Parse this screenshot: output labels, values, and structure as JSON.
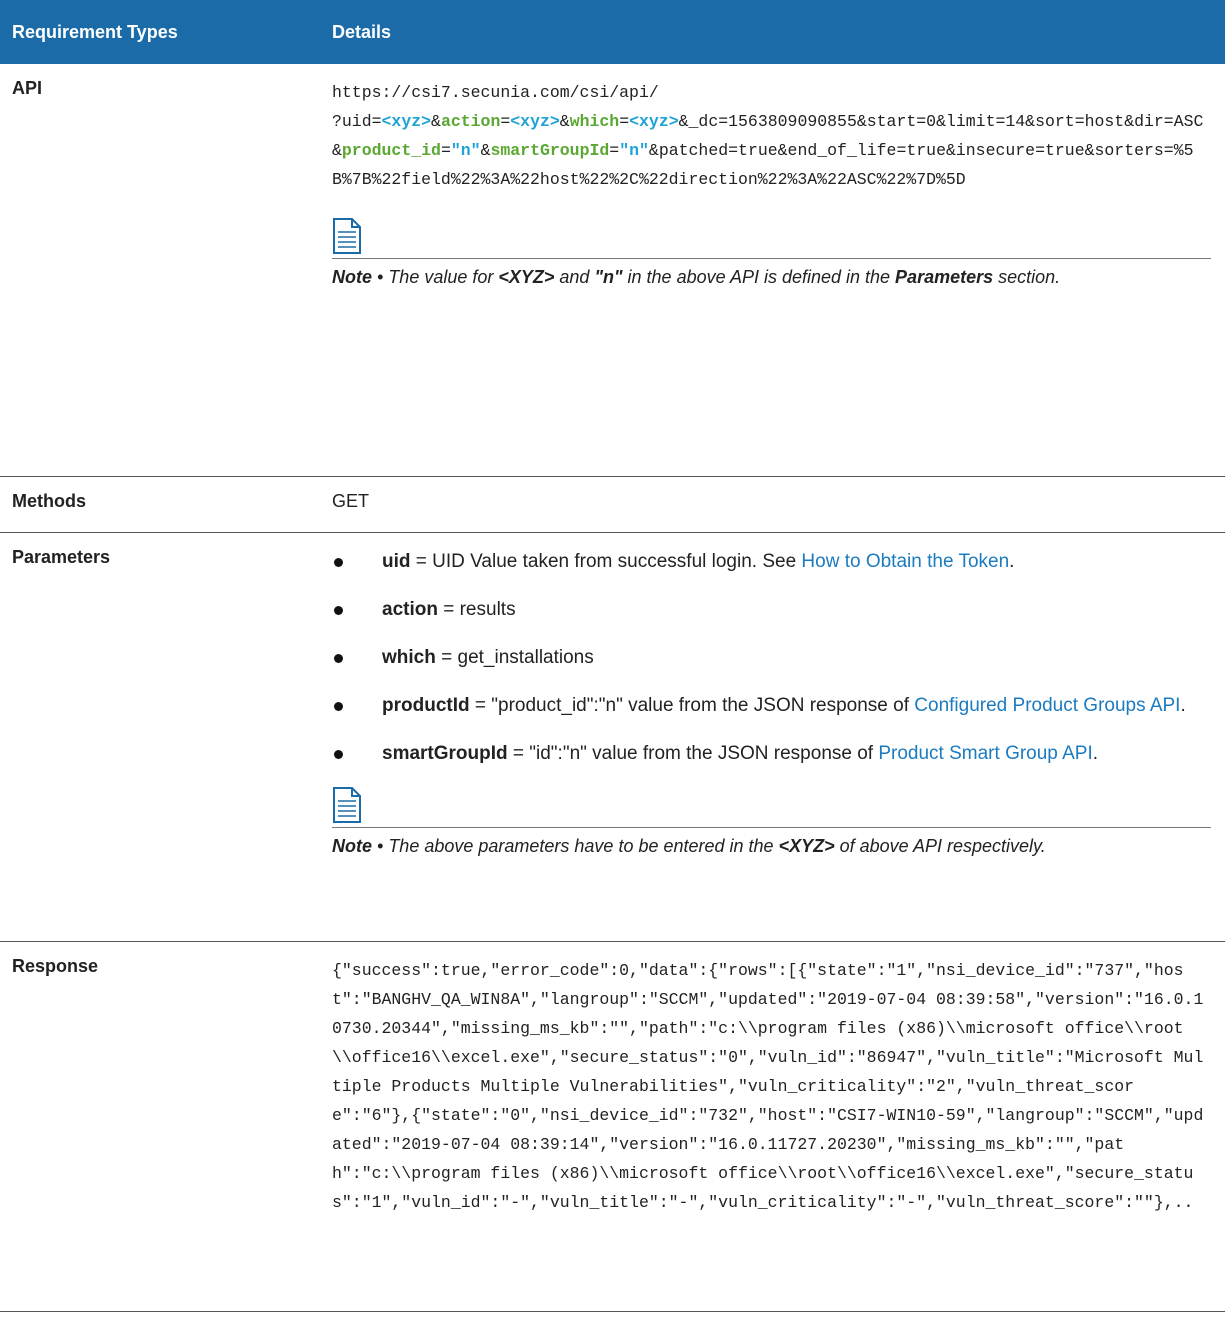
{
  "header": {
    "col1": "Requirement Types",
    "col2": "Details"
  },
  "api": {
    "label": "API",
    "url_parts": [
      {
        "t": "https://csi7.secunia.com/csi/api/\n?uid=",
        "c": ""
      },
      {
        "t": "<xyz>",
        "c": "kb"
      },
      {
        "t": "&",
        "c": ""
      },
      {
        "t": "action",
        "c": "kg"
      },
      {
        "t": "=",
        "c": ""
      },
      {
        "t": "<xyz>",
        "c": "kb"
      },
      {
        "t": "&",
        "c": ""
      },
      {
        "t": "which",
        "c": "kg"
      },
      {
        "t": "=",
        "c": ""
      },
      {
        "t": "<xyz>",
        "c": "kb"
      },
      {
        "t": "&_dc=1563809090855&start=0&limit=14&sort=host&dir=ASC&",
        "c": ""
      },
      {
        "t": "product_id",
        "c": "kg"
      },
      {
        "t": "=",
        "c": ""
      },
      {
        "t": "\"n\"",
        "c": "kb"
      },
      {
        "t": "&",
        "c": ""
      },
      {
        "t": "smartGroupId",
        "c": "kg"
      },
      {
        "t": "=",
        "c": ""
      },
      {
        "t": "\"n\"",
        "c": "kb"
      },
      {
        "t": "&patched=true&end_of_life=true&insecure=true&sorters=%5B%7B%22field%22%3A%22host%22%2C%22direction%22%3A%22ASC%22%7D%5D",
        "c": ""
      }
    ],
    "note": {
      "lead": "Note",
      "sep": " • ",
      "t1": "The value for ",
      "b1": "<XYZ>",
      "t2": " and ",
      "b2": "\"n\"",
      "t3": " in the above API is defined in the ",
      "b3": "Parameters",
      "t4": " section."
    }
  },
  "methods": {
    "label": "Methods",
    "value": "GET"
  },
  "parameters": {
    "label": "Parameters",
    "items": [
      {
        "key": "uid",
        "text": " = UID Value taken from successful login. See ",
        "link": "How to Obtain the Token",
        "after": "."
      },
      {
        "key": "action",
        "text": " = results",
        "link": "",
        "after": ""
      },
      {
        "key": "which",
        "text": " = get_installations",
        "link": "",
        "after": ""
      },
      {
        "key": "productId",
        "text": " = \"product_id\":\"n\" value from the JSON response of ",
        "link": "Configured Product Groups API",
        "after": "."
      },
      {
        "key": "smartGroupId",
        "text": " = \"id\":\"n\" value from the JSON response of ",
        "link": "Product Smart Group API",
        "after": "."
      }
    ],
    "note": {
      "lead": "Note",
      "sep": " • ",
      "t1": "The above parameters have to be entered in the ",
      "b1": "<XYZ>",
      "t2": " of above API respectively."
    }
  },
  "response": {
    "label": "Response",
    "value": "{\"success\":true,\"error_code\":0,\"data\":{\"rows\":[{\"state\":\"1\",\"nsi_device_id\":\"737\",\"host\":\"BANGHV_QA_WIN8A\",\"langroup\":\"SCCM\",\"updated\":\"2019-07-04 08:39:58\",\"version\":\"16.0.10730.20344\",\"missing_ms_kb\":\"\",\"path\":\"c:\\\\program files (x86)\\\\microsoft office\\\\root\\\\office16\\\\excel.exe\",\"secure_status\":\"0\",\"vuln_id\":\"86947\",\"vuln_title\":\"Microsoft Multiple Products Multiple Vulnerabilities\",\"vuln_criticality\":\"2\",\"vuln_threat_score\":\"6\"},{\"state\":\"0\",\"nsi_device_id\":\"732\",\"host\":\"CSI7-WIN10-59\",\"langroup\":\"SCCM\",\"updated\":\"2019-07-04 08:39:14\",\"version\":\"16.0.11727.20230\",\"missing_ms_kb\":\"\",\"path\":\"c:\\\\program files (x86)\\\\microsoft office\\\\root\\\\office16\\\\excel.exe\",\"secure_status\":\"1\",\"vuln_id\":\"-\",\"vuln_title\":\"-\",\"vuln_criticality\":\"-\",\"vuln_threat_score\":\"\"},.."
  }
}
